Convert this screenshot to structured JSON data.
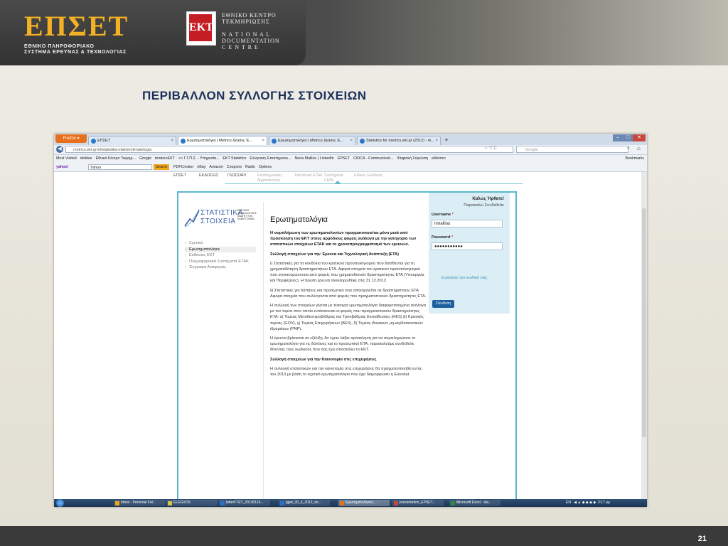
{
  "slide": {
    "org_name": "ΕΠΣΕΤ",
    "org_subtitle_1": "ΕΘΝΙΚΟ ΠΛΗΡΟΦΟΡΙΑΚΟ",
    "org_subtitle_2": "ΣΥΣΤΗΜΑ ΕΡΕΥΝΑΣ & ΤΕΧΝΟΛΟΓΙΑΣ",
    "ekt_logo": "EKT",
    "ekt_text": "ΕΘΝΙΚΟ ΚΕΝΤΡΟ\nΤΕΚΜΗΡΙΩΣΗΣ\n\nN A T I O N A L\nDOCUMENTATION\nC E N T R E",
    "title": "ΠΕΡΙΒΑΛΛΟΝ ΣΥΛΛΟΓΗΣ ΣΤΟΙΧΕΙΩΝ",
    "page_number": "21"
  },
  "browser": {
    "firefox_label": "Firefox ▾",
    "tabs": [
      {
        "label": "ΕΠΣΕΤ",
        "active": false
      },
      {
        "label": "Ερωτηματολόγια | Metrics Δείκτες Έ...",
        "active": true
      },
      {
        "label": "Ερωτηματολόγια | Metrics Δείκτες Έ...",
        "active": false
      },
      {
        "label": "Statistics for metrics.ekt.gr (2012) - m...",
        "active": false
      }
    ],
    "url": "metrics.ekt.gr/el/statistika-etak/erotimatologia",
    "search_placeholder": "Google",
    "bookmarks": [
      "Most Visited",
      "deiktes",
      "Εθνικό Κέντρο Τεκμηρ...",
      "Google",
      "tendersEKT",
      ">> Γ.Γ.Π.Σ. - Υπηρεσία...",
      "EKT Statistics",
      "Ελληνικές Επιστημονικ...",
      "Nena Malliou | LinkedIn",
      "EPSET",
      "CIRCA - Communicati...",
      "Ψηφιακή Σύγκλιση",
      "eMetrics"
    ],
    "bookmarks_menu": "Bookmarks",
    "toolbar2_brand": "yahoo!",
    "toolbar2_search_value": "Yahoo",
    "toolbar2_search_btn": "Search",
    "toolbar2_items": [
      "PDFCreator",
      "eBay",
      "Amazon",
      "Coupons",
      "Radio",
      "Options"
    ]
  },
  "site": {
    "nav": [
      {
        "label": "ΕΠΣΕΤ",
        "sub": "",
        "dim": false
      },
      {
        "label": "ΕΚΔΟΣΕΙΣ",
        "sub": "",
        "dim": false
      },
      {
        "label": "ΓΛΩΣΣΑΡΙ",
        "sub": "",
        "dim": false
      },
      {
        "label": "Επιστημονικές",
        "sub": "δημοσιεύσεις",
        "dim": true
      },
      {
        "label": "Στατιστικά ΕΤΑΚ",
        "sub": "",
        "dim": true
      },
      {
        "label": "Συστήματα",
        "sub": "CRIS",
        "dim": true
      },
      {
        "label": "Ειδικές Εκδόσεις",
        "sub": "",
        "dim": true
      }
    ],
    "logo_line1": "ΣΤΑΤΙΣΤΙΚΑ",
    "logo_line2": "ΣΤΟΙΧΕΙΑ",
    "logo_small": "ΕΡΕΥΝΑΣ ΤΕΧΝΟΛΟΓΙΚΗΣ ΑΝΑΠΤΥΞΗΣ ΚΑΙΝΟΤΟΜΙΑΣ",
    "side_menu": [
      {
        "label": "Σχετικά",
        "active": false
      },
      {
        "label": "Ερωτηματολόγια",
        "active": true
      },
      {
        "label": "Εκδόσεις ΕΚΤ",
        "active": false
      },
      {
        "label": "Πληροφοριακά Συστήματα ΕΤΑΚ",
        "active": false
      },
      {
        "label": "Έγγραφα Αναφοράς",
        "active": false
      }
    ],
    "main_title": "Ερωτηματολόγια",
    "paragraphs": [
      {
        "text": "Η συμπλήρωση των ερωτηματολογίων πραγματοποιείται μόνο μετά από πρόσκληση του ΕΚΤ στους αρμόδιους φορείς ανάλογα με την κατηγορία των στατιστικών στοιχείων ΕΤΑΚ και το χρονοπρογραμματισμό των ερευνών.",
        "bold": true
      },
      {
        "text": "Συλλογή στοιχείων για την Έρευνα και Τεχνολογική Ανάπτυξη (ΕΤΑ)",
        "bold": true
      },
      {
        "text": "i) Στατιστικές για τα κονδύλια του κρατικού προϋπολογισμού που διατίθενται για τη χρηματοδότηση δραστηριοτήτων ΕΤΑ. Αφορά στοιχεία του κρατικού προϋπολογισμού που συγκεντρώνονται από φορείς που χρηματοδοτούν δραστηριότητες ΕΤΑ (Υπουργεία και Περιφέρειες). Η πρώτη έρευνα ολοκληρώθηκε στις 31.12.2012.",
        "bold": false
      },
      {
        "text": "ii) Στατιστικές για δαπάνες και προσωπικό που απασχολείται σε δραστηριότητες ΕΤΑ. Αφορά στοιχεία που συλλέγονται από φορείς που πραγματοποιούν δραστηριότητες ΕΤΑ.",
        "bold": false
      },
      {
        "text": "Η συλλογή των στοιχείων γίνεται με τέσσερα ερωτηματολόγια διαφοροποιημένα ανάλογα με τον τομέα στον οποίο εντάσσονται οι φορείς που πραγματοποιούν δραστηριότητες ΕΤΑ: α) Τομέας Μεταδευτεροβάθμιας και Τριτοβάθμιας Εκπαίδευσης (HES) β) Κρατικός τομέας (GOV), γ) Τομέας Επιχειρήσεων (BES), δ) Τομέας ιδιωτικών μη-κερδοσκοπικών ιδρυμάτων (PNP).",
        "bold": false
      },
      {
        "text": "Η έρευνα βρίσκεται σε εξέλιξη. Αν έχετε λάβει πρόσκληση για να συμπληρώσετε το ερωτηματολόγιο για τις δαπάνες και το προσωπικό ΕΤΑ, παρακαλούμε συνδεθείτε δίνοντας τους κωδικούς που σας έχει αποστείλει το ΕΚΤ.",
        "bold": false
      },
      {
        "text": "Συλλογή στοιχείων για την Καινοτομία στις επιχειρήσεις",
        "bold": true
      },
      {
        "text": "Η συλλογή στατιστικών για την καινοτομία στις επιχειρήσεις θα πραγματοποιηθεί εντός του 2013 με βάση το σχετικό ερωτηματολόγιο που έχει διαμορφώσει η Eurostat.",
        "bold": false
      }
    ],
    "login": {
      "welcome": "Καλώς Ήρθατε!",
      "prompt": "Παρακαλώ Συνδεθείτε",
      "username_label": "Username",
      "username_value": "nmalliou",
      "password_label": "Password",
      "password_value": "●●●●●●●●●●●",
      "required_mark": "*",
      "forgot": "Ξεχάσατε τον κωδικό σας;",
      "submit": "Σύνδεση"
    }
  },
  "taskbar": {
    "items": [
      {
        "label": "Inbox - Personal Fol...",
        "active": false
      },
      {
        "label": "ELEGXOS",
        "active": false
      },
      {
        "label": "letterFTET_20130114...",
        "active": false
      },
      {
        "label": "gget_30_6_2012_do...",
        "active": false
      },
      {
        "label": "Ερωτηματολόγια | ...",
        "active": true
      },
      {
        "label": "presentation_EPSET...",
        "active": false
      },
      {
        "label": "Microsoft Excel - sta...",
        "active": false
      }
    ],
    "tray_lang": "EN",
    "clock": "3:17 μμ"
  }
}
